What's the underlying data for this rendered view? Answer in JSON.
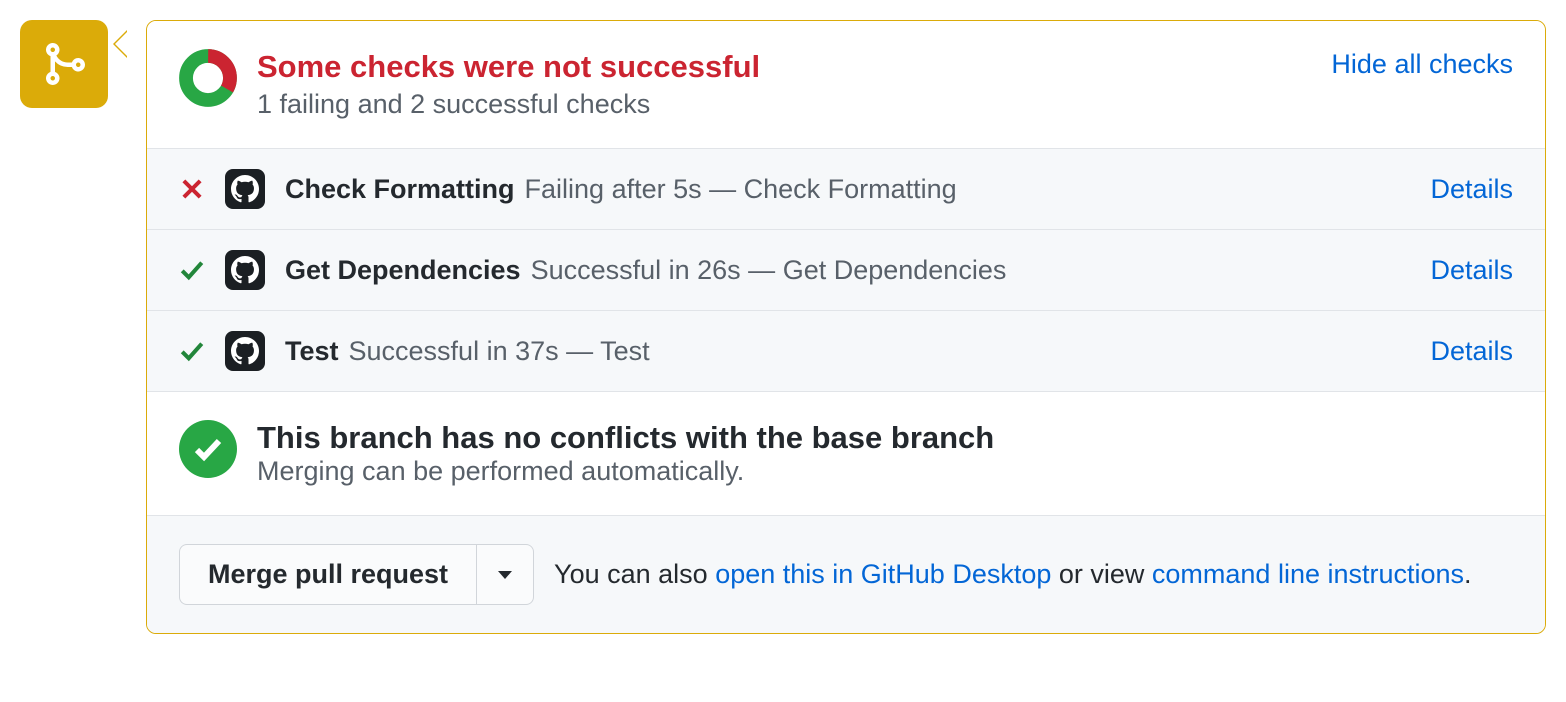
{
  "status": {
    "title": "Some checks were not successful",
    "subtitle": "1 failing and 2 successful checks",
    "toggle_label": "Hide all checks"
  },
  "checks": [
    {
      "status": "fail",
      "name": "Check Formatting",
      "desc": "Failing after 5s — Check Formatting",
      "details_label": "Details"
    },
    {
      "status": "pass",
      "name": "Get Dependencies",
      "desc": "Successful in 26s — Get Dependencies",
      "details_label": "Details"
    },
    {
      "status": "pass",
      "name": "Test",
      "desc": "Successful in 37s — Test",
      "details_label": "Details"
    }
  ],
  "conflicts": {
    "title": "This branch has no conflicts with the base branch",
    "subtitle": "Merging can be performed automatically."
  },
  "merge": {
    "button_label": "Merge pull request",
    "hint_prefix": "You can also ",
    "hint_link1": "open this in GitHub Desktop",
    "hint_mid": " or view ",
    "hint_link2": "command line instructions",
    "hint_suffix": "."
  }
}
